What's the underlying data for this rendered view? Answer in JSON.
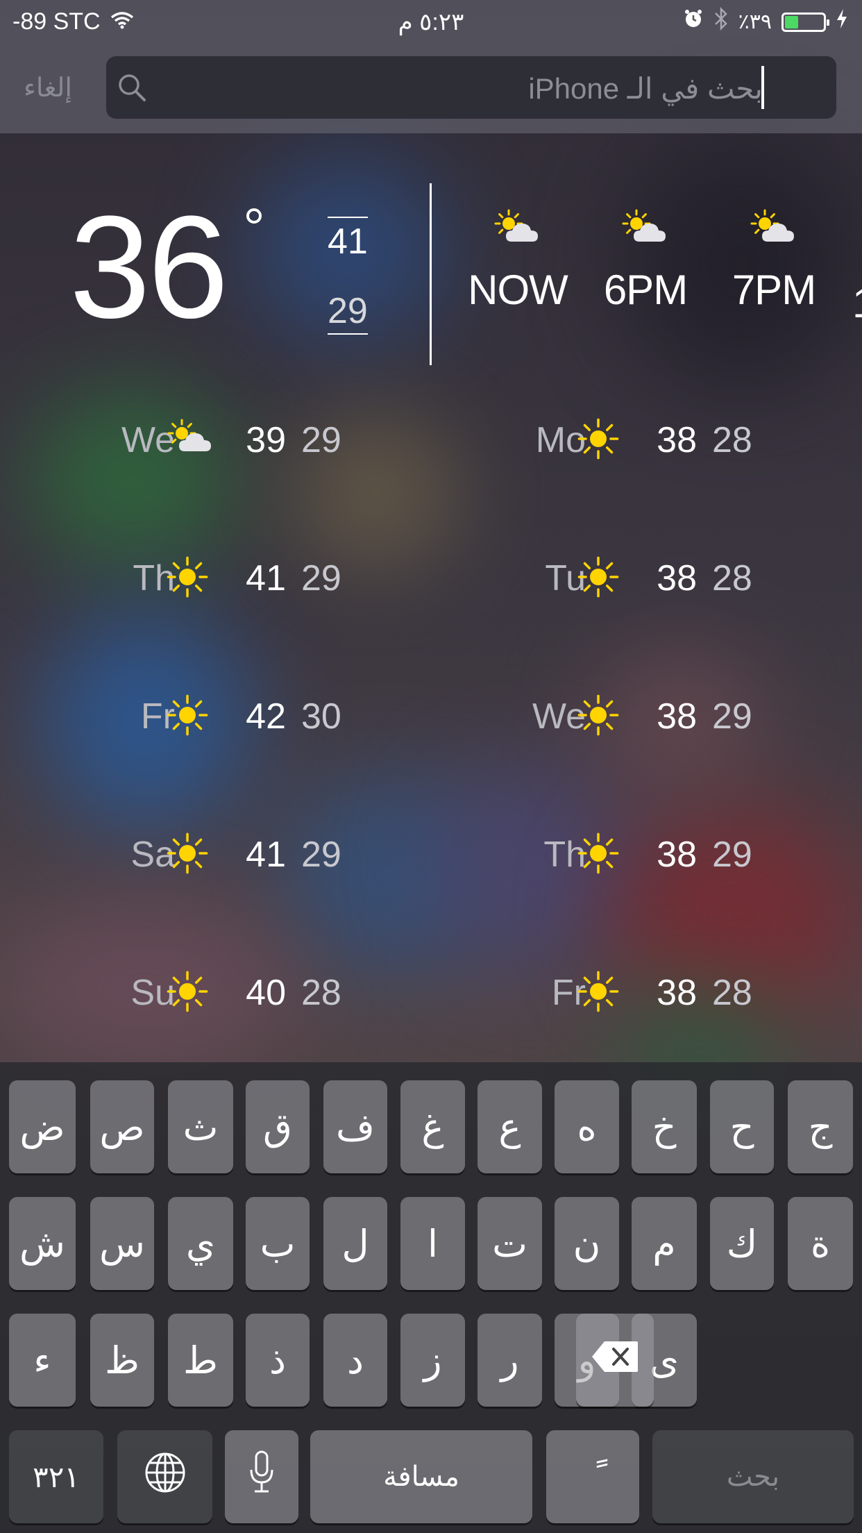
{
  "status_bar": {
    "signal_carrier": "-89 STC",
    "time": "٥:٢٣ م",
    "battery_percent": "٪٣٩",
    "battery_level": 0.38,
    "icons": [
      "wifi-icon",
      "alarm-icon",
      "bluetooth-icon",
      "battery-icon",
      "charging-icon"
    ]
  },
  "search": {
    "cancel_label": "إلغاء",
    "placeholder": "بحث في الـ iPhone"
  },
  "weather": {
    "current_temp": "36",
    "today_high": "41",
    "today_low": "29",
    "hourly": [
      {
        "label": "NOW",
        "icon": "partly-cloudy-icon"
      },
      {
        "label": "6PM",
        "icon": "partly-cloudy-icon"
      },
      {
        "label": "7PM",
        "icon": "partly-cloudy-icon"
      }
    ],
    "hourly_cutoff": "1",
    "daily_left": [
      {
        "day": "We",
        "icon": "partly-cloudy-icon",
        "high": "39",
        "low": "29"
      },
      {
        "day": "Th",
        "icon": "sun-icon",
        "high": "41",
        "low": "29"
      },
      {
        "day": "Fr",
        "icon": "sun-icon",
        "high": "42",
        "low": "30"
      },
      {
        "day": "Sa",
        "icon": "sun-icon",
        "high": "41",
        "low": "29"
      },
      {
        "day": "Su",
        "icon": "sun-icon",
        "high": "40",
        "low": "28"
      }
    ],
    "daily_right": [
      {
        "day": "Mo",
        "icon": "sun-icon",
        "high": "38",
        "low": "28"
      },
      {
        "day": "Tu",
        "icon": "sun-icon",
        "high": "38",
        "low": "28"
      },
      {
        "day": "We",
        "icon": "sun-icon",
        "high": "38",
        "low": "29"
      },
      {
        "day": "Th",
        "icon": "sun-icon",
        "high": "38",
        "low": "29"
      },
      {
        "day": "Fr",
        "icon": "sun-icon",
        "high": "38",
        "low": "28"
      }
    ]
  },
  "keyboard": {
    "row1": [
      "ض",
      "ص",
      "ث",
      "ق",
      "ف",
      "غ",
      "ع",
      "ه",
      "خ",
      "ح",
      "ج"
    ],
    "row2": [
      "ش",
      "س",
      "ي",
      "ب",
      "ل",
      "ا",
      "ت",
      "ن",
      "م",
      "ك",
      "ة"
    ],
    "row3": [
      "ء",
      "ظ",
      "ط",
      "ذ",
      "د",
      "ز",
      "ر",
      "و",
      "ى"
    ],
    "numbers_label": "٣٢١",
    "space_label": "مسافة",
    "tanween_label": "ً",
    "search_label": "بحث",
    "icons": [
      "globe-icon",
      "microphone-icon",
      "delete-icon"
    ]
  },
  "colors": {
    "sun": "#ffd400",
    "battery": "#4cd964"
  }
}
